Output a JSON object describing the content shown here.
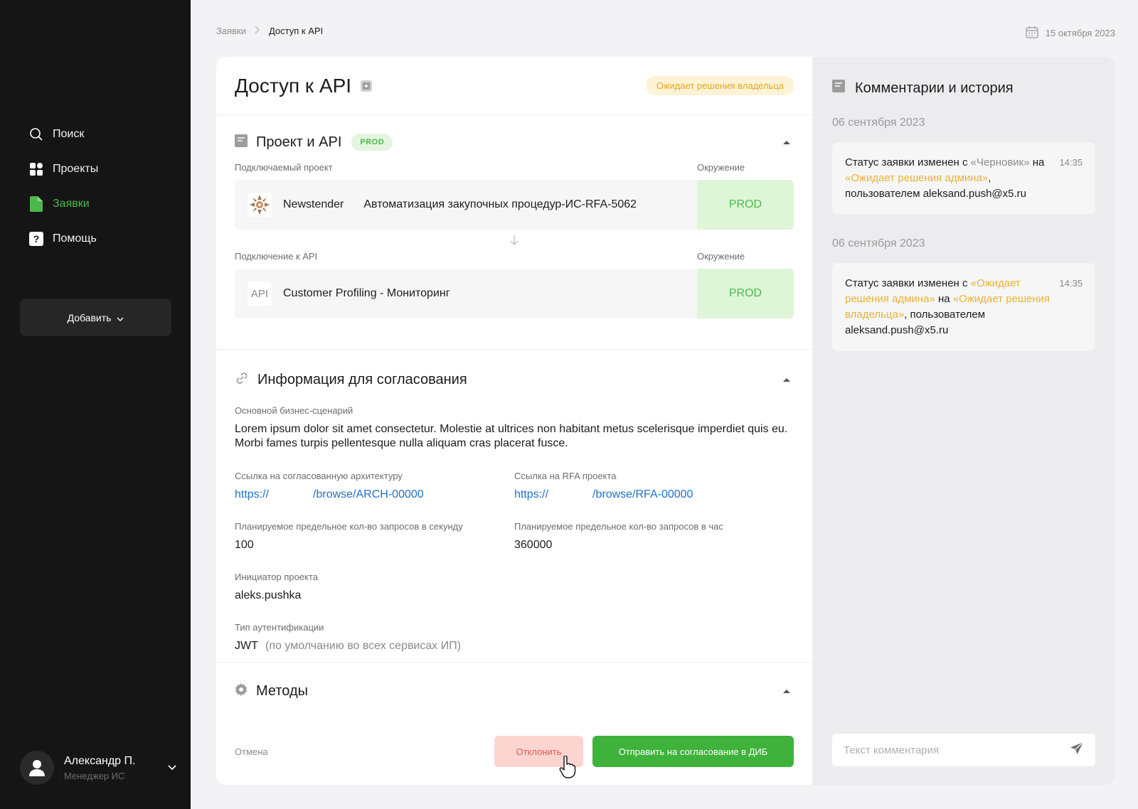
{
  "sidebar": {
    "nav": [
      {
        "label": "Поиск",
        "icon": "search-icon"
      },
      {
        "label": "Проекты",
        "icon": "grid-icon"
      },
      {
        "label": "Заявки",
        "icon": "document-icon",
        "active": true
      },
      {
        "label": "Помощь",
        "icon": "help-icon"
      }
    ],
    "add_label": "Добавить",
    "user": {
      "name": "Александр П.",
      "role": "Менеджер ИС"
    }
  },
  "breadcrumb": {
    "parent": "Заявки",
    "current": "Доступ к API"
  },
  "date": "15 октября 2023",
  "request": {
    "title": "Доступ к API",
    "status": "Ожидает решения владельца",
    "project_section": {
      "title": "Проект и API",
      "tag": "PROD",
      "project_label": "Подключаемый проект",
      "env_label": "Окружение",
      "project_name": "Newstender",
      "project_desc": "Автоматизация закупочных процедур-ИС-RFA-5062",
      "project_env": "PROD",
      "api_label": "Подключение к API",
      "api_env_label": "Окружение",
      "api_badge": "API",
      "api_name": "Customer Profiling - Мониторинг",
      "api_env": "PROD"
    },
    "approval_section": {
      "title": "Информация для согласования",
      "scenario_label": "Основной бизнес-сценарий",
      "scenario_text": "Lorem ipsum dolor sit amet consectetur. Molestie at ultrices non habitant metus scelerisque imperdiet quis eu. Morbi fames turpis pellentesque nulla aliquam cras placerat fusce.",
      "arch_label": "Ссылка на согласованную архитектуру",
      "arch_link_a": "https://",
      "arch_link_b": "/browse/ARCH-00000",
      "rfa_label": "Ссылка на RFA проекта",
      "rfa_link_a": "https://",
      "rfa_link_b": "/browse/RFA-00000",
      "rps_label": "Планируемое предельное кол-во запросов в секунду",
      "rps_value": "100",
      "rph_label": "Планируемое предельное кол-во запросов в час",
      "rph_value": "360000",
      "initiator_label": "Инициатор проекта",
      "initiator_value": "aleks.pushka",
      "auth_label": "Тип аутентификации",
      "auth_value": "JWT",
      "auth_note": "(по умолчанию во всех сервисах ИП)"
    },
    "methods_section": {
      "title": "Методы"
    },
    "actions": {
      "cancel": "Отмена",
      "reject": "Отклонить",
      "send": "Отправить на согласование в ДИБ"
    }
  },
  "comments": {
    "title": "Комментарии и история",
    "entries": [
      {
        "date": "06 сентября 2023",
        "time": "14:35",
        "prefix": "Статус заявки изменен с ",
        "from": "«Черновик»",
        "mid": " на ",
        "to": "«Ожидает решения админа»",
        "suffix": ", пользователем aleksand.push@x5.ru"
      },
      {
        "date": "06 сентября 2023",
        "time": "14:35",
        "prefix": "Статус заявки изменен с ",
        "from": "«Ожидает решения админа»",
        "mid": " на ",
        "to": "«Ожидает решения владельца»",
        "suffix": ", пользователем aleksand.push@x5.ru"
      }
    ],
    "input_placeholder": "Текст комментария"
  },
  "colors": {
    "sidebar_bg": "#151515",
    "accent_green": "#3fb23b",
    "status_yellow": "#e3a91e",
    "reject_red": "#e25a4d",
    "link_blue": "#1f72c8"
  }
}
